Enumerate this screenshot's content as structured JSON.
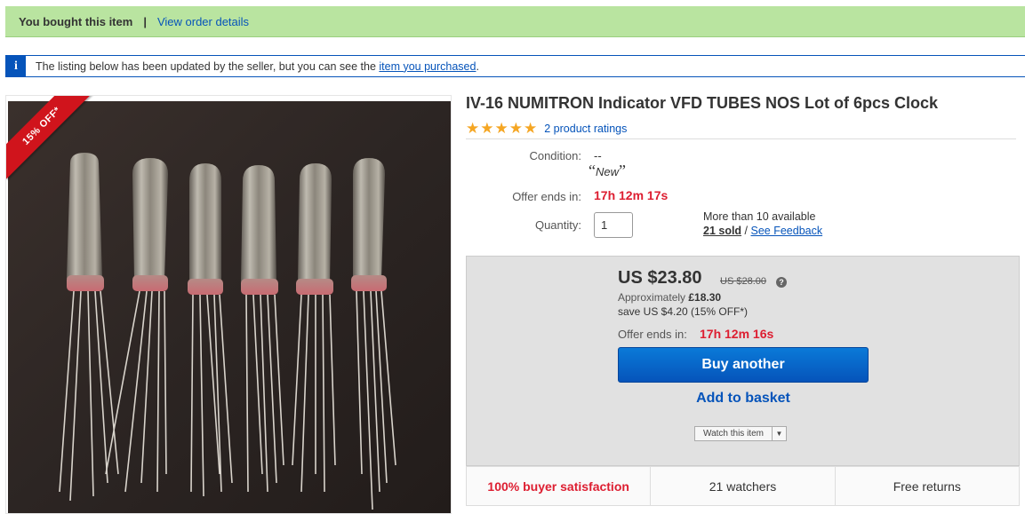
{
  "bought_bar": {
    "message": "You bought this item",
    "separator": "|",
    "link": "View order details"
  },
  "info_bar": {
    "icon": "i",
    "text_before": "The listing below has been updated by the seller, but you can see the ",
    "link": "item you purchased",
    "text_after": "."
  },
  "image": {
    "ribbon": "15% OFF*"
  },
  "title": "IV-16 NUMITRON Indicator VFD TUBES NOS Lot of 6pcs Clock",
  "rating": {
    "stars": 5,
    "star_glyph": "★",
    "ratings_link": "2 product ratings"
  },
  "condition": {
    "label": "Condition:",
    "value": "--",
    "open_quote": "“",
    "new": "New",
    "close_quote": "”"
  },
  "offer": {
    "label": "Offer ends in:",
    "value": "17h 12m 17s"
  },
  "quantity": {
    "label": "Quantity:",
    "value": "1"
  },
  "availability": {
    "text": "More than 10 available",
    "sold": "21 sold",
    "slash": " / ",
    "feedback": "See Feedback"
  },
  "buybox": {
    "price": "US $23.80",
    "original_price": "US $28.00",
    "help": "?",
    "approx_label": "Approximately ",
    "approx_value": "£18.30",
    "save": "save US $4.20 (15% OFF*)",
    "offer_label": "Offer ends in:",
    "offer_value": "17h 12m 16s",
    "buy_button": "Buy another",
    "basket_link": "Add to basket",
    "watch_label": "Watch this item",
    "watch_dropdown": "▼"
  },
  "badges": [
    "100% buyer satisfaction",
    "21 watchers",
    "Free returns"
  ],
  "colors": {
    "link": "#0654ba",
    "alert_red": "#dd1e31",
    "bought_green": "#b9e4a0",
    "star": "#f5a623"
  }
}
